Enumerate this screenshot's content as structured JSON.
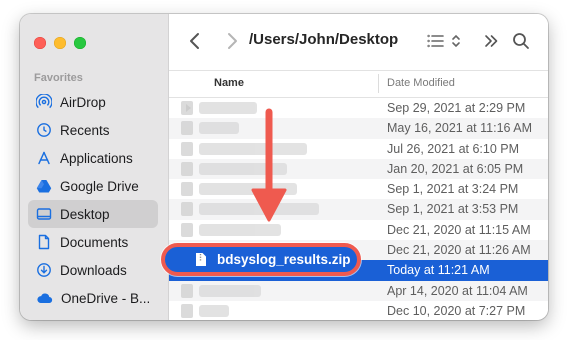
{
  "sidebar": {
    "section_label": "Favorites",
    "items": [
      {
        "label": "AirDrop",
        "icon": "airdrop-icon"
      },
      {
        "label": "Recents",
        "icon": "clock-icon"
      },
      {
        "label": "Applications",
        "icon": "applications-icon"
      },
      {
        "label": "Google Drive",
        "icon": "google-drive-icon"
      },
      {
        "label": "Desktop",
        "icon": "desktop-icon"
      },
      {
        "label": "Documents",
        "icon": "document-icon"
      },
      {
        "label": "Downloads",
        "icon": "downloads-icon"
      },
      {
        "label": "OneDrive - B...",
        "icon": "cloud-icon"
      }
    ]
  },
  "toolbar": {
    "path_title": "/Users/John/Desktop"
  },
  "columns": {
    "name": "Name",
    "date_modified": "Date Modified"
  },
  "rows": [
    {
      "date": "Sep 29, 2021 at 2:29 PM"
    },
    {
      "date": "May 16, 2021 at 11:16 AM"
    },
    {
      "date": "Jul 26, 2021 at 6:10 PM"
    },
    {
      "date": "Jan 20, 2021 at 6:05 PM"
    },
    {
      "date": "Sep 1, 2021 at 3:24 PM"
    },
    {
      "date": "Sep 1, 2021 at 3:53 PM"
    },
    {
      "date": "Dec 21, 2020 at 11:15 AM"
    },
    {
      "date": "Dec 21, 2020 at 11:26 AM"
    },
    {
      "date": "Today at 11:21 AM"
    },
    {
      "date": "Apr 14, 2020 at 11:04 AM"
    },
    {
      "date": "Dec 10, 2020 at 7:27 PM"
    }
  ],
  "selected_file": {
    "name": "bdsyslog_results.zip"
  },
  "colors": {
    "accent": "#1a60d6",
    "annotation": "#ef5a4f"
  }
}
